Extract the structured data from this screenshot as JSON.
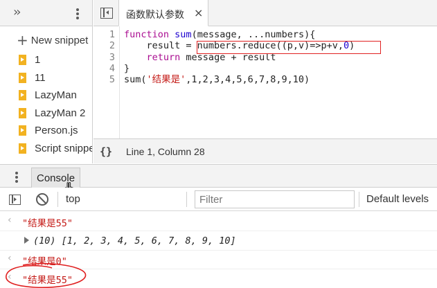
{
  "sidebar": {
    "new_snippet": "New snippet",
    "files": [
      "1",
      "11",
      "LazyMan",
      "LazyMan 2",
      "Person.js",
      "Script snippet"
    ]
  },
  "editor": {
    "tab_title": "函数默认参数",
    "line_numbers": [
      "1",
      "2",
      "3",
      "4",
      "5"
    ],
    "code": {
      "l1_kw": "function",
      "l1_fn": "sum",
      "l1_rest": "(message, ...numbers){",
      "l2_pre": "    result = ",
      "l2_expr_a": "numbers.reduce((p,v)=>p+v,",
      "l2_zero": "0",
      "l2_expr_b": ")",
      "l3_kw": "return",
      "l3_rest": " message + result",
      "l4": "}",
      "l5_fn": "sum(",
      "l5_str": "'结果是'",
      "l5_args": ",1,2,3,4,5,6,7,8,9,10)"
    },
    "highlight_color": "#e02020",
    "status": "Line 1, Column 28",
    "braces": "{}"
  },
  "drawer": {
    "console_tab": "Console"
  },
  "console": {
    "context": "top",
    "filter_placeholder": "Filter",
    "levels": "Default levels",
    "messages": [
      {
        "text": "\"结果是55\""
      },
      {
        "count": "(10)",
        "items": "[1, 2, 3, 4, 5, 6, 7, 8, 9, 10]"
      },
      {
        "text": "\"结果是0\""
      },
      {
        "text": "\"结果是55\""
      }
    ],
    "annotation_color": "#e02020"
  }
}
